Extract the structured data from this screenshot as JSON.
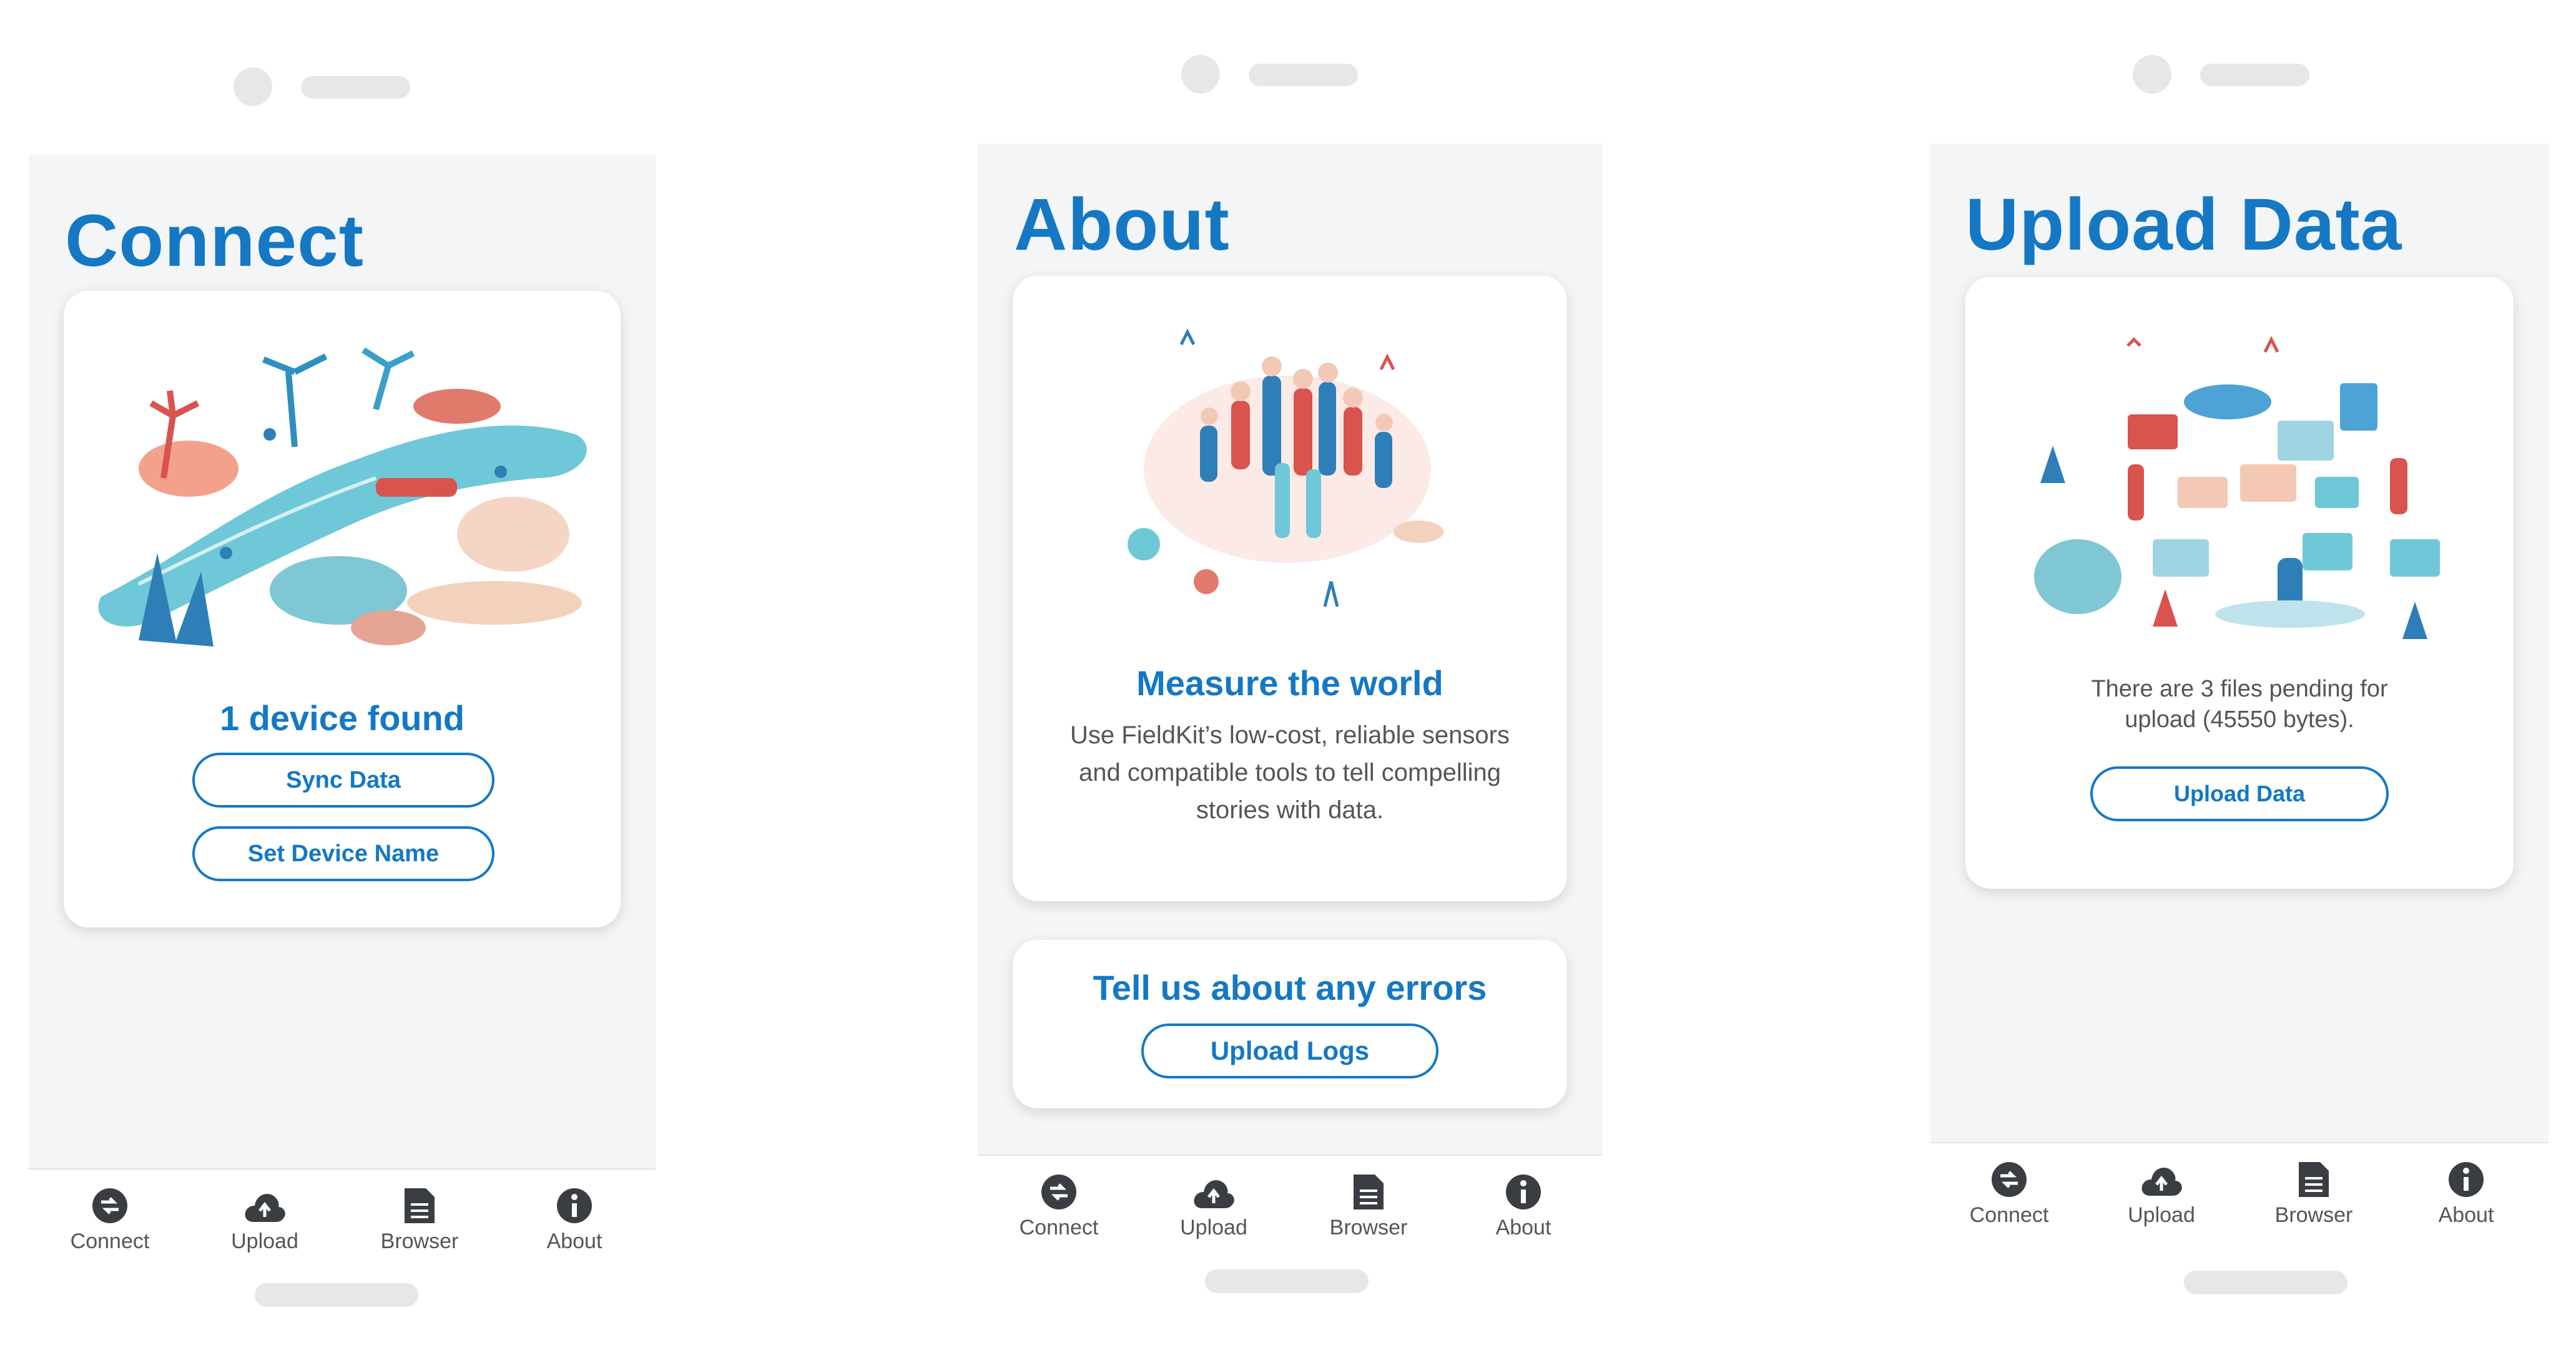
{
  "colors": {
    "accent": "#1478c4",
    "icon": "#3a3d42",
    "screen_bg": "#f4f5f7"
  },
  "tabs": [
    {
      "label": "Connect",
      "icon": "connect-icon"
    },
    {
      "label": "Upload",
      "icon": "cloud-upload-icon"
    },
    {
      "label": "Browser",
      "icon": "document-icon"
    },
    {
      "label": "About",
      "icon": "info-icon"
    }
  ],
  "connect": {
    "title": "Connect",
    "illustration": "river-map-illustration",
    "status": "1 device found",
    "sync_label": "Sync Data",
    "set_name_label": "Set Device Name"
  },
  "about": {
    "title": "About",
    "illustration": "crowd-illustration",
    "heading": "Measure the world",
    "description": "Use FieldKit’s low-cost, reliable sensors and compatible tools to tell compelling stories with data.",
    "errors_heading": "Tell us about any errors",
    "upload_logs_label": "Upload Logs"
  },
  "upload": {
    "title": "Upload Data",
    "illustration": "data-workspace-illustration",
    "pending_text": "There are 3 files pending for upload (45550 bytes).",
    "upload_label": "Upload Data"
  }
}
